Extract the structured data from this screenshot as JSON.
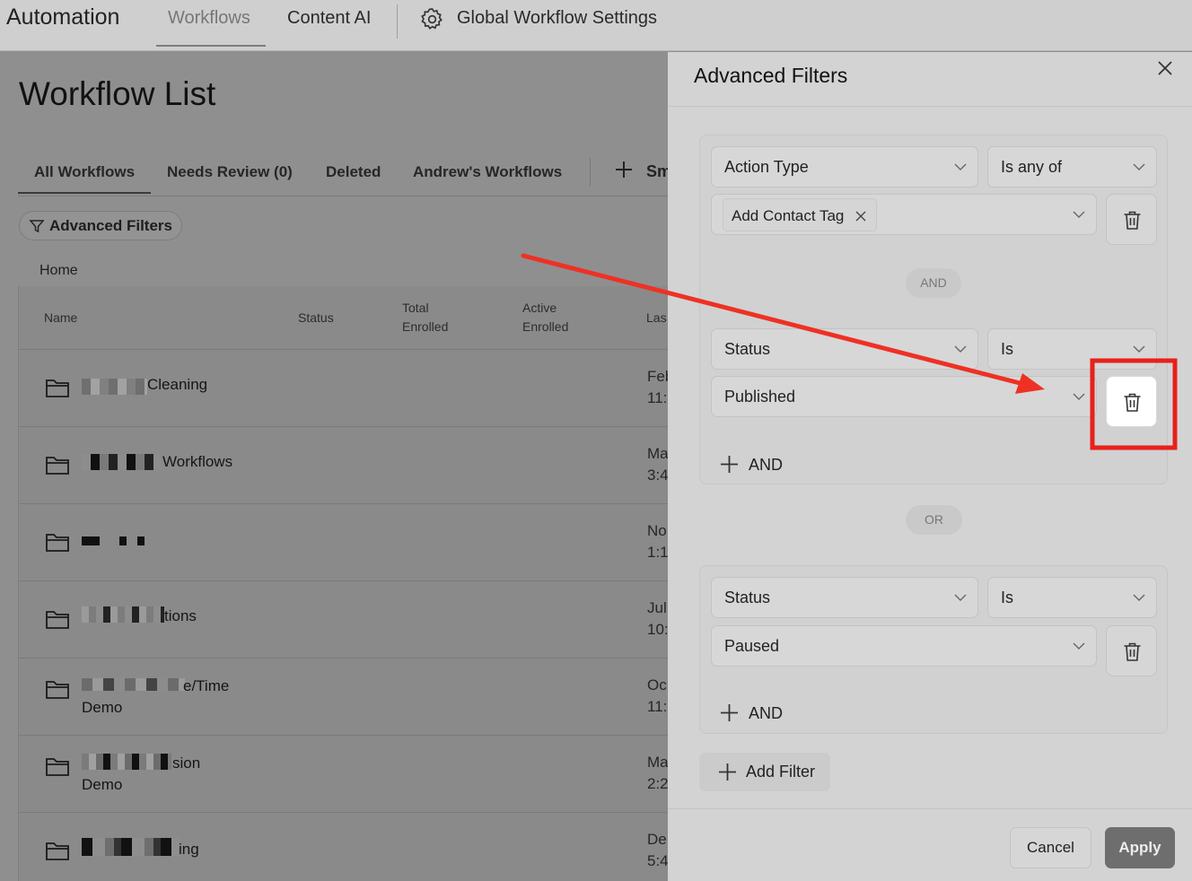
{
  "topnav": {
    "brand": "Automation",
    "tabs": {
      "workflows": "Workflows",
      "content_ai": "Content AI",
      "global_settings": "Global Workflow Settings"
    }
  },
  "main": {
    "title": "Workflow List",
    "tabs": [
      "All Workflows",
      "Needs Review (0)",
      "Deleted",
      "Andrew's Workflows"
    ],
    "smart_list_partial": "Sm",
    "advanced_filters_button": "Advanced Filters",
    "breadcrumb": "Home",
    "table": {
      "headers": {
        "name": "Name",
        "status": "Status",
        "total_1": "Total",
        "total_2": "Enrolled",
        "active_1": "Active",
        "active_2": "Enrolled",
        "last": "Las"
      },
      "rows": [
        {
          "name": "Cleaning",
          "name_line2": "",
          "date_1": "Feb",
          "date_2": "11:"
        },
        {
          "name": "Workflows",
          "name_line2": "",
          "date_1": "Ma",
          "date_2": "3:4"
        },
        {
          "name": "",
          "name_line2": "",
          "date_1": "No",
          "date_2": "1:1"
        },
        {
          "name": "tions",
          "name_line2": "",
          "date_1": "Jul",
          "date_2": "10:"
        },
        {
          "name": "e/Time",
          "name_line2": "Demo",
          "date_1": "Oc",
          "date_2": "11:"
        },
        {
          "name": "sion",
          "name_line2": "Demo",
          "date_1": "Ma",
          "date_2": "2:2"
        },
        {
          "name": "ing",
          "name_line2": "",
          "date_1": "De",
          "date_2": "5:4"
        }
      ]
    }
  },
  "panel": {
    "title": "Advanced Filters",
    "groups": [
      {
        "conditions": [
          {
            "field": "Action Type",
            "operator": "Is any of",
            "chip": "Add Contact Tag"
          },
          {
            "field": "Status",
            "operator": "Is",
            "value": "Published"
          }
        ],
        "and_connector": "AND",
        "add_and": "AND"
      },
      {
        "conditions": [
          {
            "field": "Status",
            "operator": "Is",
            "value": "Paused"
          }
        ],
        "add_and": "AND"
      }
    ],
    "or_connector": "OR",
    "add_filter": "Add Filter",
    "cancel": "Cancel",
    "apply": "Apply"
  },
  "annotation": {
    "arrow_color": "#ee3124",
    "highlight_color": "#e8201b"
  }
}
